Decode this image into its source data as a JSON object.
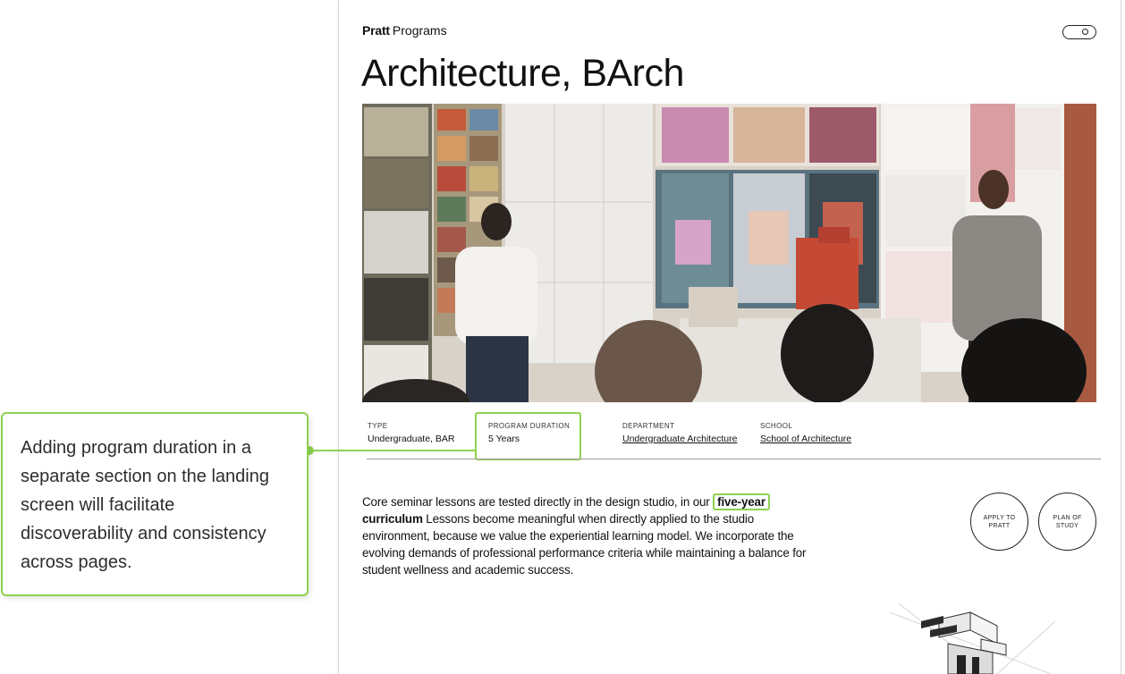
{
  "header": {
    "brand_logo": "Pratt",
    "brand_section": "Programs",
    "search_icon": "search-icon"
  },
  "page": {
    "title": "Architecture, BArch"
  },
  "meta": {
    "type_label": "TYPE",
    "type_value": "Undergraduate, BAR",
    "duration_label": "PROGRAM DURATION",
    "duration_value": "5 Years",
    "department_label": "DEPARTMENT",
    "department_value": "Undergraduate Architecture",
    "school_label": "SCHOOL",
    "school_value": "School of Architecture"
  },
  "body": {
    "intro": "Core seminar lessons are tested directly in the design studio, in our ",
    "highlight_1": "five-year",
    "highlight_2": "curriculum",
    "rest": " Lessons become meaningful when directly applied to the studio environment, because we value the experiential learning model. We incorporate the evolving demands of professional performance criteria while maintaining a balance for student wellness and academic success."
  },
  "actions": {
    "apply": "APPLY TO PRATT",
    "plan": "PLAN OF STUDY"
  },
  "annotation": {
    "text": "Adding program duration in a separate section on the landing screen will facilitate discoverability and consistency across pages.",
    "accent_color": "#8fd14f"
  }
}
